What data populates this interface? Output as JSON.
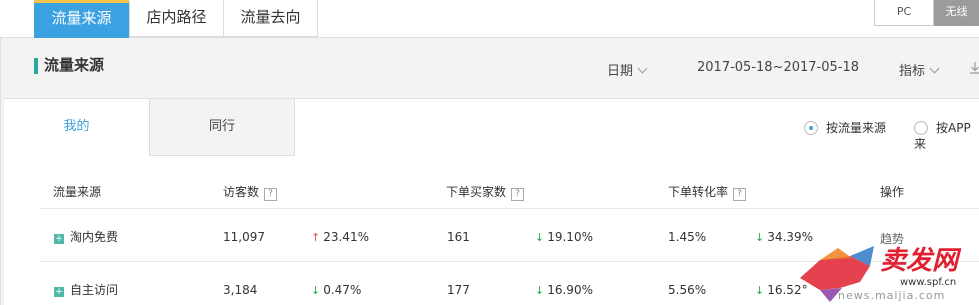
{
  "top_tabs": [
    {
      "label": "流量来源"
    },
    {
      "label": "店内路径"
    },
    {
      "label": "流量去向"
    }
  ],
  "device_switch": {
    "pc": "PC",
    "wireless": "无线"
  },
  "header": {
    "title": "流量来源",
    "date_label": "日期",
    "date_range": "2017-05-18~2017-05-18",
    "metric_label": "指标"
  },
  "sub_tabs": [
    {
      "label": "我的"
    },
    {
      "label": "同行"
    }
  ],
  "radios": [
    {
      "label": "按流量来源",
      "selected": true
    },
    {
      "label": "按APP来",
      "selected": false
    }
  ],
  "table": {
    "headers": [
      "流量来源",
      "访客数",
      "下单买家数",
      "下单转化率",
      "操作"
    ],
    "rows": [
      {
        "source": "淘内免费",
        "visitors": "11,097",
        "visitors_change": "23.41%",
        "visitors_dir": "up",
        "buyers": "161",
        "buyers_change": "19.10%",
        "buyers_dir": "down",
        "rate": "1.45%",
        "rate_change": "34.39%",
        "rate_dir": "down",
        "action": "趋势"
      },
      {
        "source": "自主访问",
        "visitors": "3,184",
        "visitors_change": "0.47%",
        "visitors_dir": "down",
        "buyers": "177",
        "buyers_change": "16.90%",
        "buyers_dir": "down",
        "rate": "5.56%",
        "rate_change": "16.52°",
        "rate_dir": "down",
        "action": ""
      }
    ]
  },
  "watermark": {
    "brand": "卖发网",
    "url": "www.spf.cn",
    "url2": "news.maijia.com"
  },
  "colors": {
    "accent": "#3ba1e0",
    "tab_top": "#f5c24a",
    "up": "#e05050",
    "down": "#2aa84a",
    "title_mark": "#29a8a0"
  },
  "icons": {
    "expand": "plus-square-icon",
    "help": "question-icon",
    "download": "download-icon"
  }
}
